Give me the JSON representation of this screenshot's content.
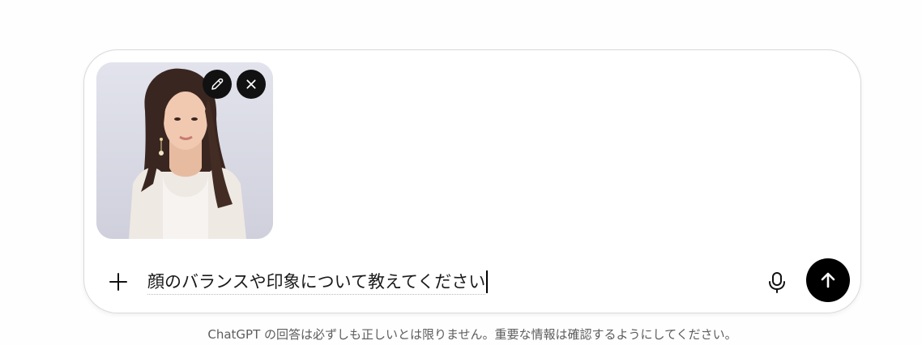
{
  "composer": {
    "input_value": "顔のバランスや印象について教えてください",
    "attachment": {
      "type": "image",
      "edit_icon": "pencil-icon",
      "remove_icon": "close-icon"
    },
    "plus_icon": "plus-icon",
    "mic_icon": "microphone-icon",
    "send_icon": "arrow-up-icon"
  },
  "footer": {
    "disclaimer": "ChatGPT の回答は必ずしも正しいとは限りません。重要な情報は確認するようにしてください。"
  }
}
